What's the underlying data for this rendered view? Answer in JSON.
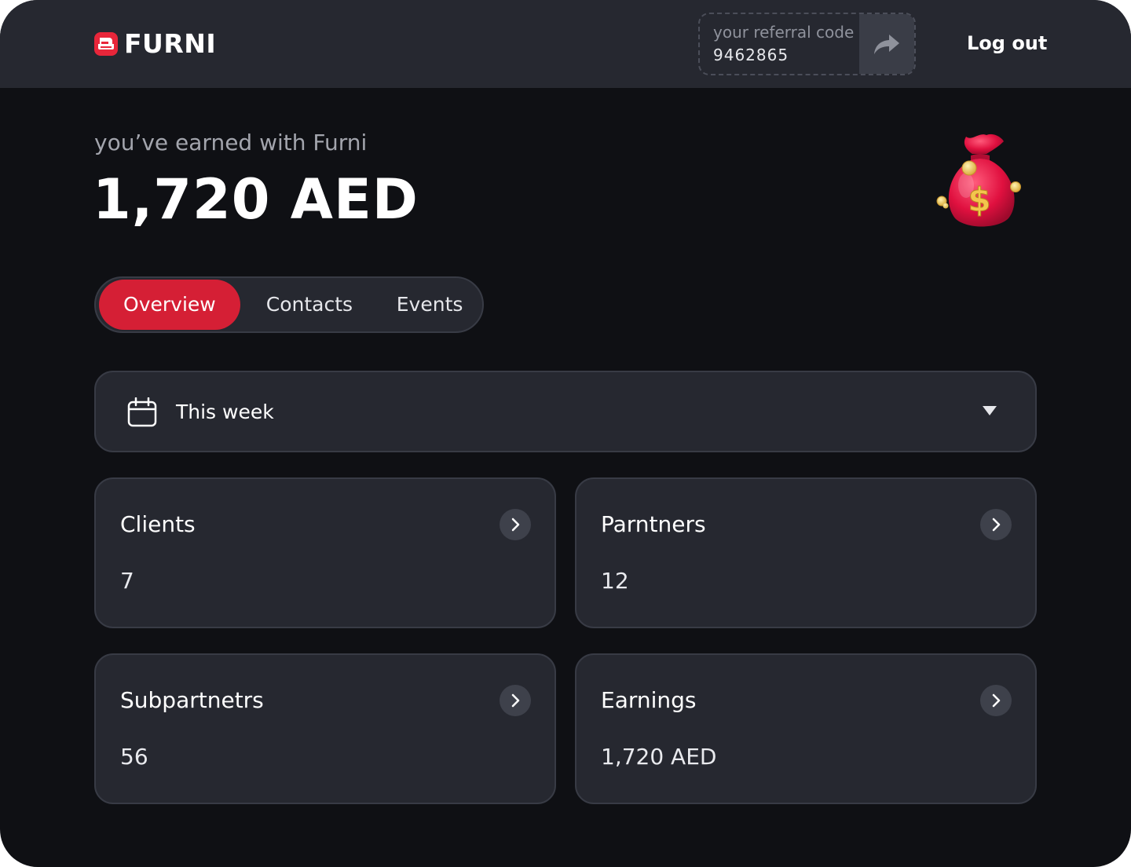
{
  "header": {
    "brand": "FURNI",
    "referral": {
      "label": "your referral code",
      "code": "9462865"
    },
    "logout_label": "Log out"
  },
  "earnings": {
    "label": "you’ve earned with Furni",
    "amount": "1,720 AED"
  },
  "tabs": [
    {
      "label": "Overview",
      "active": true
    },
    {
      "label": "Contacts",
      "active": false
    },
    {
      "label": "Events",
      "active": false
    }
  ],
  "period": {
    "selected": "This week"
  },
  "cards": [
    {
      "title": "Clients",
      "value": "7"
    },
    {
      "title": "Parntners",
      "value": "12"
    },
    {
      "title": "Subpartnetrs",
      "value": "56"
    },
    {
      "title": "Earnings",
      "value": "1,720 AED"
    }
  ],
  "colors": {
    "accent": "#d51f35",
    "background": "#0f1014",
    "surface": "#262830",
    "border": "#383b45"
  },
  "icons": {
    "logo": "furni-logo-icon",
    "share": "share-arrow-icon",
    "money": "money-bag-icon",
    "calendar": "calendar-icon",
    "caret": "caret-down-icon",
    "card_arrow": "chevron-right-icon"
  }
}
